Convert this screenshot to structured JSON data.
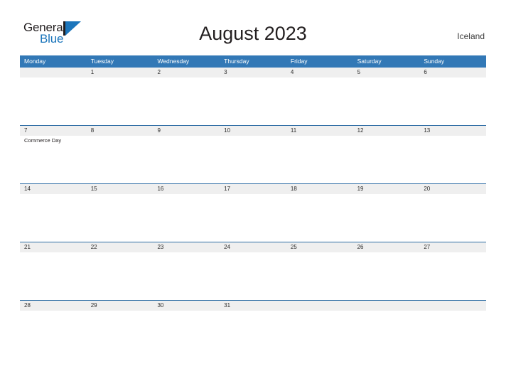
{
  "brand": {
    "name_part1": "General",
    "name_part2": "Blue",
    "primary_color": "#1b75bb"
  },
  "header": {
    "title": "August 2023",
    "country": "Iceland",
    "header_bg_color": "#3278b6",
    "band_color": "#efefef"
  },
  "calendar": {
    "weekdays": [
      "Monday",
      "Tuesday",
      "Wednesday",
      "Thursday",
      "Friday",
      "Saturday",
      "Sunday"
    ],
    "weeks": [
      {
        "days": [
          {
            "num": "",
            "events": []
          },
          {
            "num": "1",
            "events": []
          },
          {
            "num": "2",
            "events": []
          },
          {
            "num": "3",
            "events": []
          },
          {
            "num": "4",
            "events": []
          },
          {
            "num": "5",
            "events": []
          },
          {
            "num": "6",
            "events": []
          }
        ]
      },
      {
        "days": [
          {
            "num": "7",
            "events": [
              "Commerce Day"
            ]
          },
          {
            "num": "8",
            "events": []
          },
          {
            "num": "9",
            "events": []
          },
          {
            "num": "10",
            "events": []
          },
          {
            "num": "11",
            "events": []
          },
          {
            "num": "12",
            "events": []
          },
          {
            "num": "13",
            "events": []
          }
        ]
      },
      {
        "days": [
          {
            "num": "14",
            "events": []
          },
          {
            "num": "15",
            "events": []
          },
          {
            "num": "16",
            "events": []
          },
          {
            "num": "17",
            "events": []
          },
          {
            "num": "18",
            "events": []
          },
          {
            "num": "19",
            "events": []
          },
          {
            "num": "20",
            "events": []
          }
        ]
      },
      {
        "days": [
          {
            "num": "21",
            "events": []
          },
          {
            "num": "22",
            "events": []
          },
          {
            "num": "23",
            "events": []
          },
          {
            "num": "24",
            "events": []
          },
          {
            "num": "25",
            "events": []
          },
          {
            "num": "26",
            "events": []
          },
          {
            "num": "27",
            "events": []
          }
        ]
      },
      {
        "days": [
          {
            "num": "28",
            "events": []
          },
          {
            "num": "29",
            "events": []
          },
          {
            "num": "30",
            "events": []
          },
          {
            "num": "31",
            "events": []
          },
          {
            "num": "",
            "events": []
          },
          {
            "num": "",
            "events": []
          },
          {
            "num": "",
            "events": []
          }
        ]
      }
    ]
  }
}
